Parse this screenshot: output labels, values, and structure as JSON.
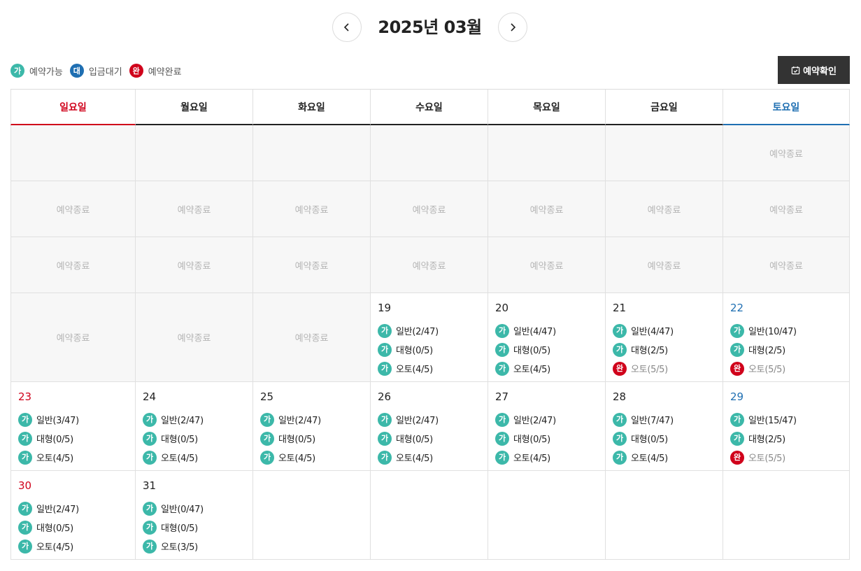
{
  "header": {
    "title": "2025년 03월",
    "prev_icon": "chevron-left-icon",
    "next_icon": "chevron-right-icon"
  },
  "legend": [
    {
      "badge": "가",
      "label": "예약가능",
      "type": "ga",
      "color": "#3cb8a9"
    },
    {
      "badge": "대",
      "label": "입금대기",
      "type": "dae",
      "color": "#1f6fb2"
    },
    {
      "badge": "완",
      "label": "예약완료",
      "type": "wan",
      "color": "#d0021b"
    }
  ],
  "confirm_button": {
    "label": "예약확인",
    "icon": "calendar-check-icon"
  },
  "weekdays": [
    "일요일",
    "월요일",
    "화요일",
    "수요일",
    "목요일",
    "금요일",
    "토요일"
  ],
  "closed_label": "예약종료",
  "weeks": [
    [
      {
        "type": "closed-empty"
      },
      {
        "type": "closed-empty"
      },
      {
        "type": "closed-empty"
      },
      {
        "type": "closed-empty"
      },
      {
        "type": "closed-empty"
      },
      {
        "type": "closed-empty"
      },
      {
        "type": "closed"
      }
    ],
    [
      {
        "type": "closed"
      },
      {
        "type": "closed"
      },
      {
        "type": "closed"
      },
      {
        "type": "closed"
      },
      {
        "type": "closed"
      },
      {
        "type": "closed"
      },
      {
        "type": "closed"
      }
    ],
    [
      {
        "type": "closed"
      },
      {
        "type": "closed"
      },
      {
        "type": "closed"
      },
      {
        "type": "closed"
      },
      {
        "type": "closed"
      },
      {
        "type": "closed"
      },
      {
        "type": "closed"
      }
    ],
    [
      {
        "type": "closed"
      },
      {
        "type": "closed"
      },
      {
        "type": "closed"
      },
      {
        "type": "day",
        "date": "19",
        "slots": [
          {
            "badge": "가",
            "status": "ga",
            "text": "일반(2/47)"
          },
          {
            "badge": "가",
            "status": "ga",
            "text": "대형(0/5)"
          },
          {
            "badge": "가",
            "status": "ga",
            "text": "오토(4/5)"
          }
        ]
      },
      {
        "type": "day",
        "date": "20",
        "slots": [
          {
            "badge": "가",
            "status": "ga",
            "text": "일반(4/47)"
          },
          {
            "badge": "가",
            "status": "ga",
            "text": "대형(0/5)"
          },
          {
            "badge": "가",
            "status": "ga",
            "text": "오토(4/5)"
          }
        ]
      },
      {
        "type": "day",
        "date": "21",
        "slots": [
          {
            "badge": "가",
            "status": "ga",
            "text": "일반(4/47)"
          },
          {
            "badge": "가",
            "status": "ga",
            "text": "대형(2/5)"
          },
          {
            "badge": "완",
            "status": "wan",
            "text": "오토(5/5)"
          }
        ]
      },
      {
        "type": "day",
        "date": "22",
        "slots": [
          {
            "badge": "가",
            "status": "ga",
            "text": "일반(10/47)"
          },
          {
            "badge": "가",
            "status": "ga",
            "text": "대형(2/5)"
          },
          {
            "badge": "완",
            "status": "wan",
            "text": "오토(5/5)"
          }
        ]
      }
    ],
    [
      {
        "type": "day",
        "date": "23",
        "slots": [
          {
            "badge": "가",
            "status": "ga",
            "text": "일반(3/47)"
          },
          {
            "badge": "가",
            "status": "ga",
            "text": "대형(0/5)"
          },
          {
            "badge": "가",
            "status": "ga",
            "text": "오토(4/5)"
          }
        ]
      },
      {
        "type": "day",
        "date": "24",
        "slots": [
          {
            "badge": "가",
            "status": "ga",
            "text": "일반(2/47)"
          },
          {
            "badge": "가",
            "status": "ga",
            "text": "대형(0/5)"
          },
          {
            "badge": "가",
            "status": "ga",
            "text": "오토(4/5)"
          }
        ]
      },
      {
        "type": "day",
        "date": "25",
        "slots": [
          {
            "badge": "가",
            "status": "ga",
            "text": "일반(2/47)"
          },
          {
            "badge": "가",
            "status": "ga",
            "text": "대형(0/5)"
          },
          {
            "badge": "가",
            "status": "ga",
            "text": "오토(4/5)"
          }
        ]
      },
      {
        "type": "day",
        "date": "26",
        "slots": [
          {
            "badge": "가",
            "status": "ga",
            "text": "일반(2/47)"
          },
          {
            "badge": "가",
            "status": "ga",
            "text": "대형(0/5)"
          },
          {
            "badge": "가",
            "status": "ga",
            "text": "오토(4/5)"
          }
        ]
      },
      {
        "type": "day",
        "date": "27",
        "slots": [
          {
            "badge": "가",
            "status": "ga",
            "text": "일반(2/47)"
          },
          {
            "badge": "가",
            "status": "ga",
            "text": "대형(0/5)"
          },
          {
            "badge": "가",
            "status": "ga",
            "text": "오토(4/5)"
          }
        ]
      },
      {
        "type": "day",
        "date": "28",
        "slots": [
          {
            "badge": "가",
            "status": "ga",
            "text": "일반(7/47)"
          },
          {
            "badge": "가",
            "status": "ga",
            "text": "대형(0/5)"
          },
          {
            "badge": "가",
            "status": "ga",
            "text": "오토(4/5)"
          }
        ]
      },
      {
        "type": "day",
        "date": "29",
        "slots": [
          {
            "badge": "가",
            "status": "ga",
            "text": "일반(15/47)"
          },
          {
            "badge": "가",
            "status": "ga",
            "text": "대형(2/5)"
          },
          {
            "badge": "완",
            "status": "wan",
            "text": "오토(5/5)"
          }
        ]
      }
    ],
    [
      {
        "type": "day",
        "date": "30",
        "slots": [
          {
            "badge": "가",
            "status": "ga",
            "text": "일반(2/47)"
          },
          {
            "badge": "가",
            "status": "ga",
            "text": "대형(0/5)"
          },
          {
            "badge": "가",
            "status": "ga",
            "text": "오토(4/5)"
          }
        ]
      },
      {
        "type": "day",
        "date": "31",
        "slots": [
          {
            "badge": "가",
            "status": "ga",
            "text": "일반(0/47)"
          },
          {
            "badge": "가",
            "status": "ga",
            "text": "대형(0/5)"
          },
          {
            "badge": "가",
            "status": "ga",
            "text": "오토(3/5)"
          }
        ]
      },
      {
        "type": "empty"
      },
      {
        "type": "empty"
      },
      {
        "type": "empty"
      },
      {
        "type": "empty"
      },
      {
        "type": "empty"
      }
    ]
  ]
}
